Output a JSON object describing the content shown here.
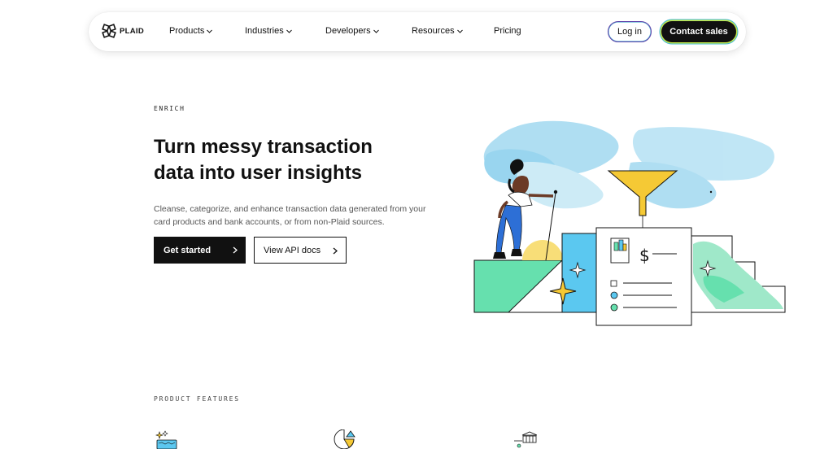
{
  "nav": {
    "logo_text": "PLAID",
    "items": [
      {
        "label": "Products",
        "has_dropdown": true
      },
      {
        "label": "Industries",
        "has_dropdown": true
      },
      {
        "label": "Developers",
        "has_dropdown": true
      },
      {
        "label": "Resources",
        "has_dropdown": true
      },
      {
        "label": "Pricing",
        "has_dropdown": false
      }
    ],
    "login_label": "Log in",
    "contact_label": "Contact sales"
  },
  "hero": {
    "eyebrow": "ENRICH",
    "title": "Turn messy transaction data into user insights",
    "description": "Cleanse, categorize, and enhance transaction data generated from your card products and bank accounts, or from non-Plaid sources.",
    "primary_cta": "Get started",
    "secondary_cta": "View API docs",
    "illustration_dollar": "$"
  },
  "features": {
    "label": "PRODUCT FEATURES",
    "icons": [
      "sparkle-card-icon",
      "pie-chart-icon",
      "bank-icon"
    ]
  },
  "colors": {
    "accent_blue": "#5bc8f0",
    "accent_green": "#66e0ae",
    "accent_yellow": "#f5c935",
    "text_dark": "#111111"
  }
}
